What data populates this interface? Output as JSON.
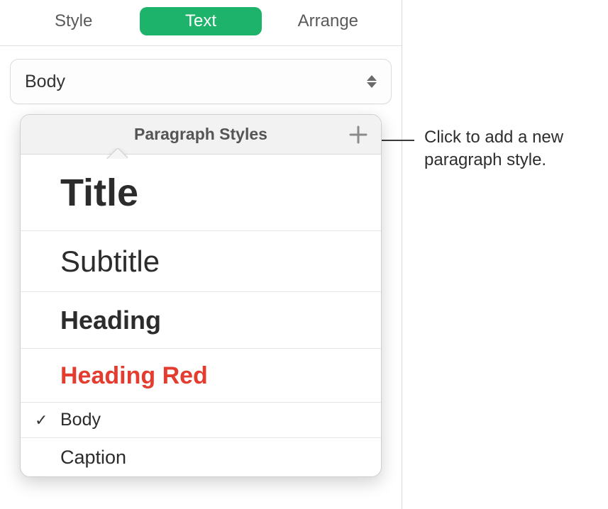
{
  "tabs": {
    "style": "Style",
    "text": "Text",
    "arrange": "Arrange",
    "active": "text"
  },
  "dropdown": {
    "selected": "Body"
  },
  "popover": {
    "title": "Paragraph Styles",
    "items": {
      "title": "Title",
      "subtitle": "Subtitle",
      "heading": "Heading",
      "heading_red": "Heading Red",
      "body": "Body",
      "caption": "Caption"
    },
    "selected": "body",
    "checkmark": "✓"
  },
  "callout": {
    "text": "Click to add a new paragraph style."
  }
}
